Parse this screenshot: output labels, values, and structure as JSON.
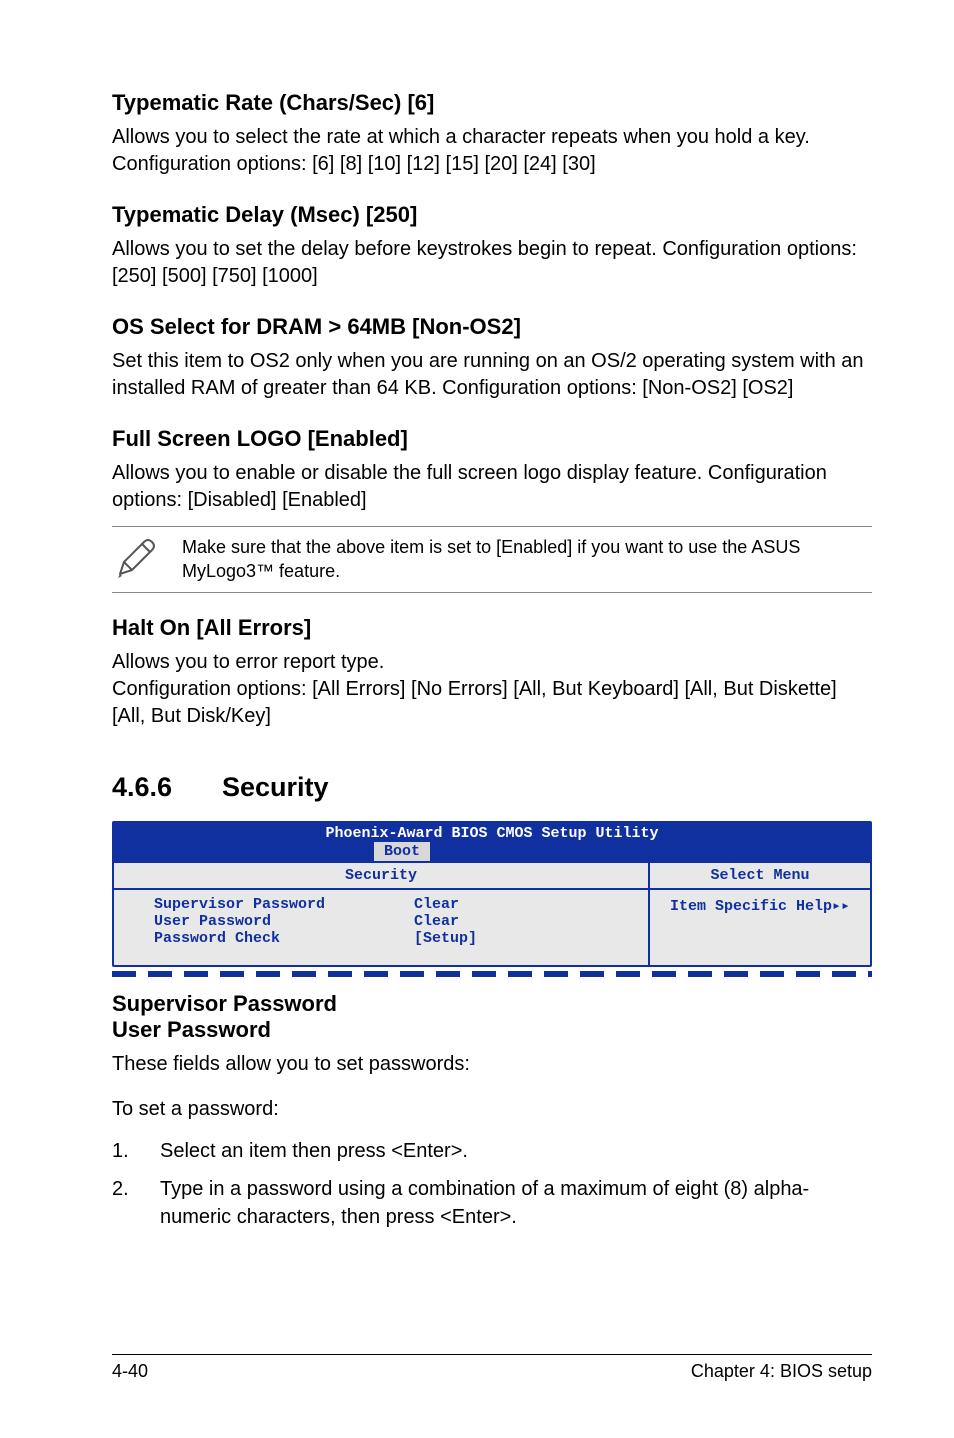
{
  "s1": {
    "title": "Typematic Rate (Chars/Sec) [6]",
    "body": "Allows you to select the rate at which a character repeats when you hold a key. Configuration options: [6] [8] [10] [12] [15] [20] [24] [30]"
  },
  "s2": {
    "title": "Typematic Delay (Msec) [250]",
    "body": "Allows you to set the delay before keystrokes begin to repeat. Configuration options: [250] [500] [750] [1000]"
  },
  "s3": {
    "title": "OS Select for DRAM > 64MB [Non-OS2]",
    "body": "Set this item to OS2 only when you are running on an OS/2 operating system with an installed RAM of greater than 64 KB. Configuration options: [Non-OS2] [OS2]"
  },
  "s4": {
    "title": "Full Screen LOGO [Enabled]",
    "body": "Allows you to enable or disable the full screen logo display feature. Configuration options: [Disabled] [Enabled]"
  },
  "note": "Make sure that the above item is set to [Enabled] if you want to use the ASUS MyLogo3™ feature.",
  "s5": {
    "title": "Halt On [All Errors]",
    "line1": "Allows you to error report type.",
    "line2": "Configuration options: [All Errors] [No Errors] [All, But Keyboard] [All, But Diskette] [All, But Disk/Key]"
  },
  "section": {
    "num": "4.6.6",
    "title": "Security"
  },
  "bios": {
    "title": "Phoenix-Award BIOS CMOS Setup Utility",
    "tab": "Boot",
    "left_header": "Security",
    "right_header": "Select Menu",
    "rows": [
      {
        "label": "Supervisor Password",
        "value": "Clear"
      },
      {
        "label": "User Password",
        "value": "Clear"
      },
      {
        "label": "Password Check",
        "value": "[Setup]"
      }
    ],
    "right_help": "Item Specific Help▸▸"
  },
  "s6": {
    "title1": "Supervisor Password",
    "title2": "User Password",
    "body1": "These fields allow you to set passwords:",
    "body2": "To set a password:"
  },
  "steps": [
    "Select an item then press <Enter>.",
    "Type in a password using a combination of a maximum of eight (8) alpha-numeric characters, then press <Enter>."
  ],
  "footer": {
    "left": "4-40",
    "right": "Chapter 4: BIOS setup"
  }
}
